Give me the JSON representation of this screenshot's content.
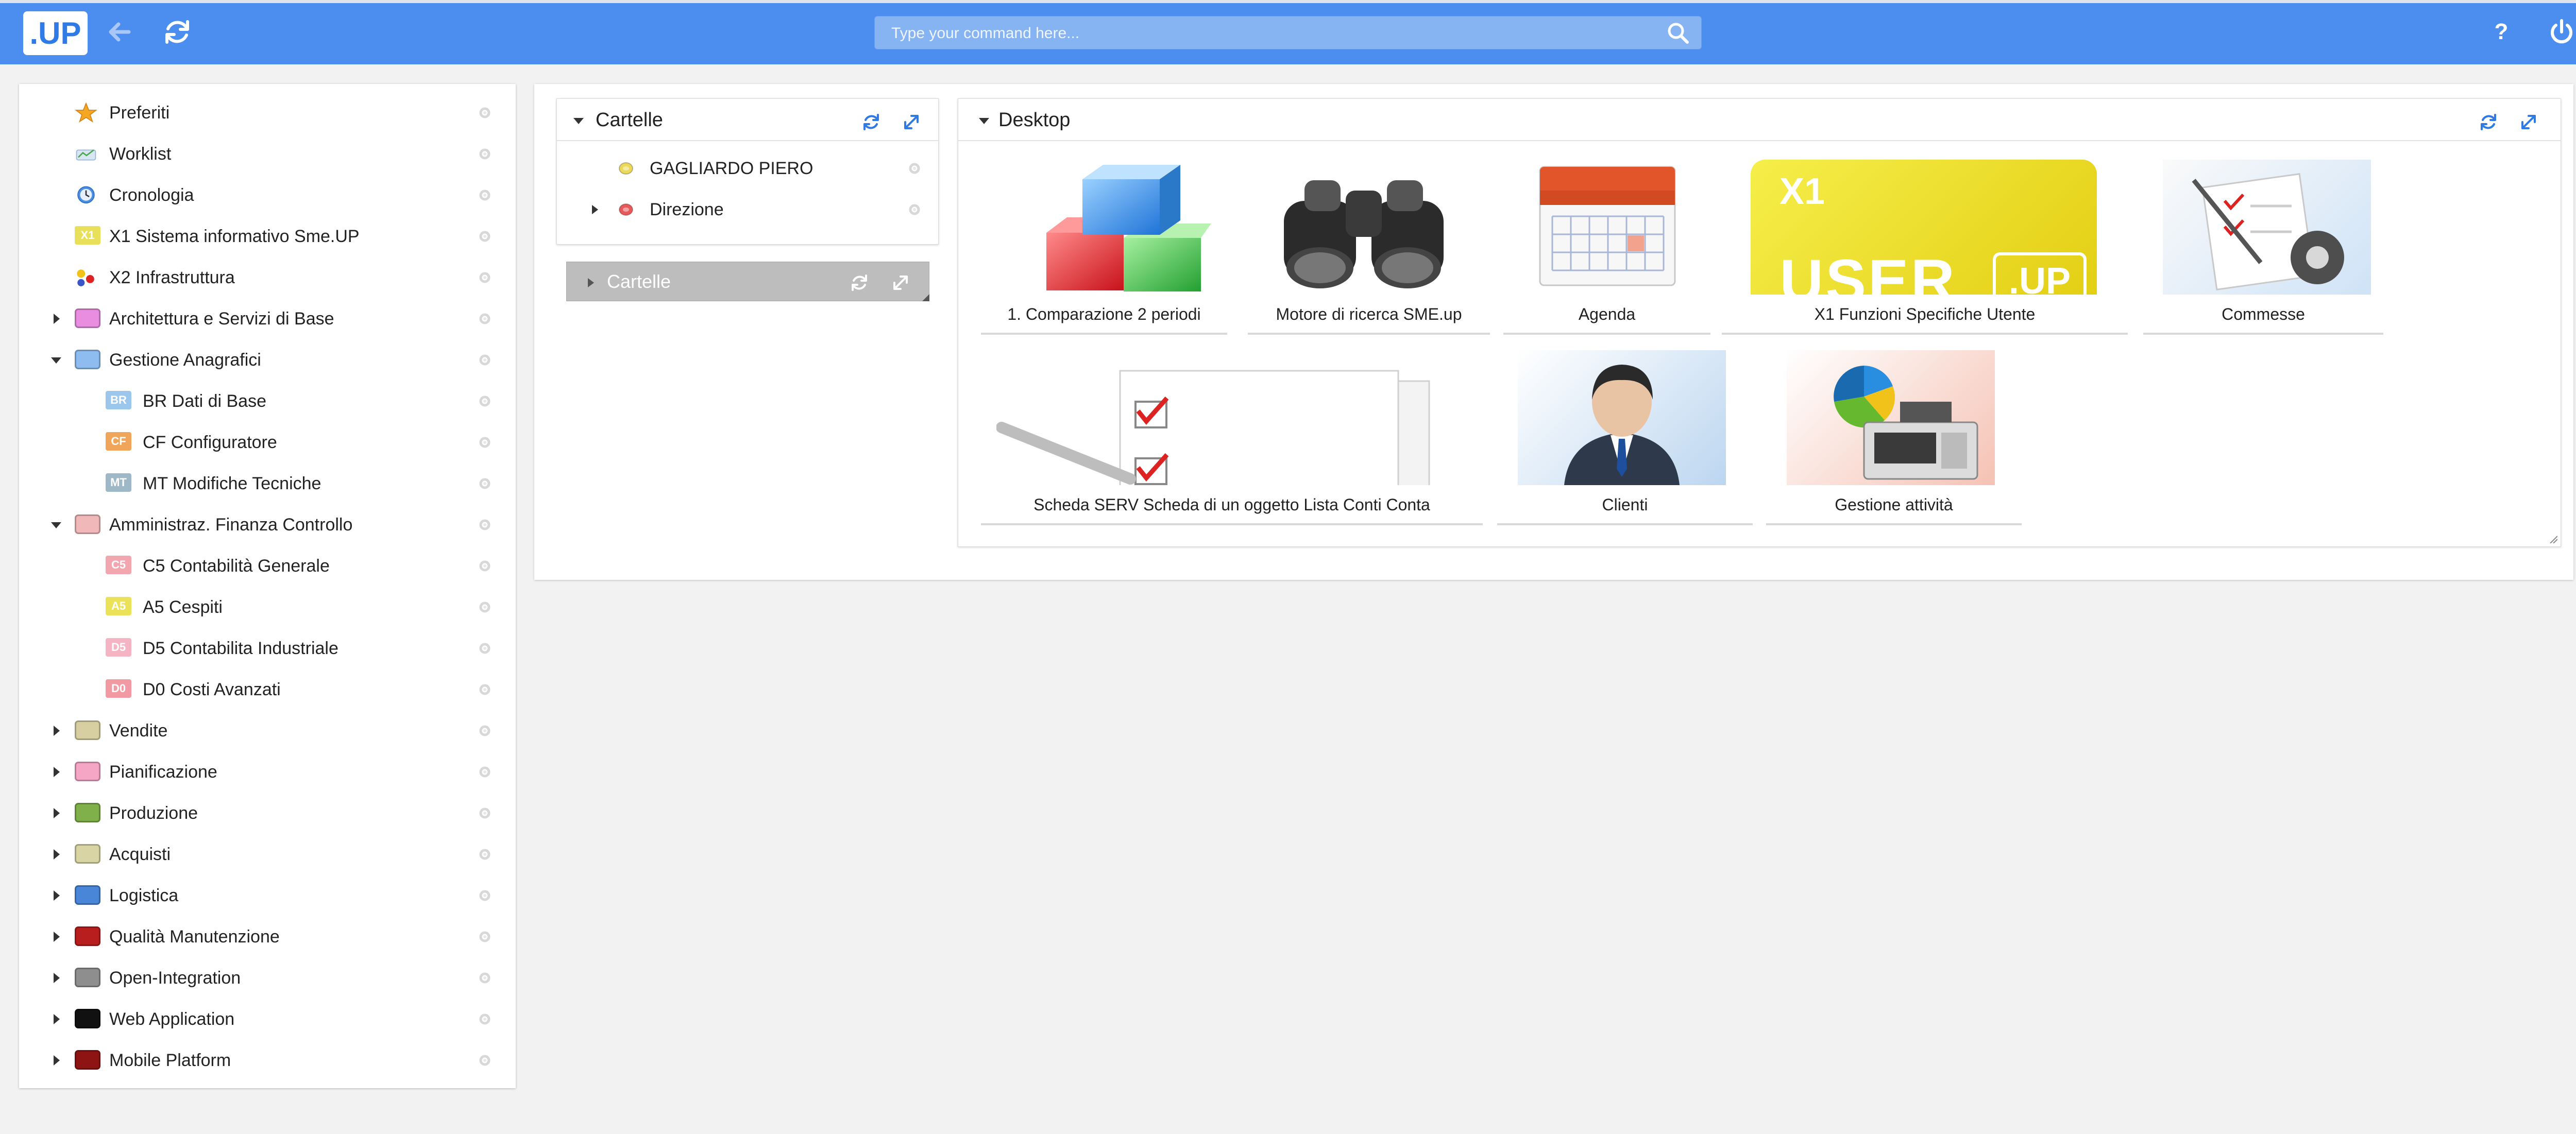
{
  "app": {
    "logo_text": ".UP",
    "command_placeholder": "Type your command here...",
    "help_label": "?",
    "accent": "#4c8ef0"
  },
  "icons": {
    "back": "arrow-left-icon",
    "refresh": "refresh-icon",
    "search": "search-icon",
    "help": "question-icon",
    "power": "power-icon",
    "gear": "gear-icon",
    "expand": "expand-icon"
  },
  "sidebar": {
    "items": [
      {
        "label": "Preferiti",
        "icon": "star-icon",
        "expandable": false
      },
      {
        "label": "Worklist",
        "icon": "worklist-icon",
        "expandable": false
      },
      {
        "label": "Cronologia",
        "icon": "clock-icon",
        "expandable": false
      },
      {
        "label": "X1 Sistema informativo Sme.UP",
        "icon": "x1-tag-icon",
        "tag": "X1",
        "expandable": false
      },
      {
        "label": "X2 Infrastruttura",
        "icon": "network-icon",
        "expandable": false
      },
      {
        "label": "Architettura e Servizi di Base",
        "color": "#e98de0",
        "expandable": true,
        "expanded": false
      },
      {
        "label": "Gestione Anagrafici",
        "color": "#8ebcf0",
        "expandable": true,
        "expanded": true
      },
      {
        "label": "BR Dati di Base",
        "tag": "BR",
        "color": "#9cc7ec",
        "level": 2
      },
      {
        "label": "CF Configuratore",
        "tag": "CF",
        "color": "#f0a65a",
        "level": 2
      },
      {
        "label": "MT Modifiche Tecniche",
        "tag": "MT",
        "color": "#9fb8c8",
        "level": 2
      },
      {
        "label": "Amministraz. Finanza Controllo",
        "color": "#f0b8b8",
        "expandable": true,
        "expanded": true
      },
      {
        "label": "C5 Contabilità Generale",
        "tag": "C5",
        "color": "#f2a6b0",
        "level": 2
      },
      {
        "label": "A5 Cespiti",
        "tag": "A5",
        "color": "#ece25a",
        "level": 2
      },
      {
        "label": "D5 Contabilita Industriale",
        "tag": "D5",
        "color": "#f4b4c4",
        "level": 2
      },
      {
        "label": "D0 Costi Avanzati",
        "tag": "D0",
        "color": "#f29aa4",
        "level": 2
      },
      {
        "label": "Vendite",
        "color": "#d7cfa2",
        "expandable": true,
        "expanded": false
      },
      {
        "label": "Pianificazione",
        "color": "#f5a6c4",
        "expandable": true,
        "expanded": false
      },
      {
        "label": "Produzione",
        "color": "#7fb04a",
        "expandable": true,
        "expanded": false
      },
      {
        "label": "Acquisti",
        "color": "#d8d4a4",
        "expandable": true,
        "expanded": false
      },
      {
        "label": "Logistica",
        "color": "#4a86d8",
        "expandable": true,
        "expanded": false
      },
      {
        "label": "Qualità Manutenzione",
        "color": "#b81e1e",
        "expandable": true,
        "expanded": false
      },
      {
        "label": "Open-Integration",
        "color": "#8e8e8e",
        "expandable": true,
        "expanded": false
      },
      {
        "label": "Web Application",
        "color": "#111111",
        "expandable": true,
        "expanded": false
      },
      {
        "label": "Mobile Platform",
        "color": "#8e1414",
        "expandable": true,
        "expanded": false
      }
    ]
  },
  "cartelle": {
    "title": "Cartelle",
    "items": [
      {
        "label": "GAGLIARDO PIERO",
        "color": "#ecd95a",
        "expandable": false
      },
      {
        "label": "Direzione",
        "color": "#e85a5a",
        "expandable": true
      }
    ],
    "collapsed_title": "Cartelle"
  },
  "desktop": {
    "title": "Desktop",
    "tiles": [
      {
        "label": "1. Comparazione 2 periodi",
        "icon": "cubes-icon"
      },
      {
        "label": "Motore di ricerca SME.up",
        "icon": "binoculars-icon"
      },
      {
        "label": "Agenda",
        "icon": "calendar-icon"
      },
      {
        "label": "X1 Funzioni Specifiche Utente",
        "icon": "user-up-banner-icon",
        "banner_top": "X1",
        "banner_text": "USER",
        "banner_badge": ".UP"
      },
      {
        "label": "Commesse",
        "icon": "checklist-gear-icon"
      },
      {
        "label": "Scheda SERV Scheda di un oggetto Lista Conti Conta",
        "icon": "checklist-pen-icon"
      },
      {
        "label": "Clienti",
        "icon": "businessman-icon"
      },
      {
        "label": "Gestione attività",
        "icon": "cash-register-chart-icon"
      }
    ]
  }
}
